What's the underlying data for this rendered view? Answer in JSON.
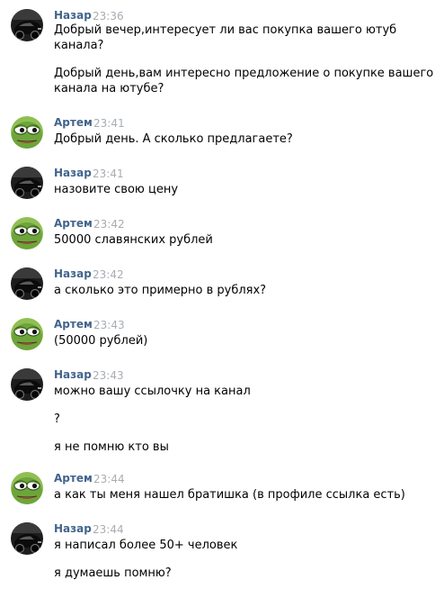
{
  "messages": [
    {
      "author": "Назар",
      "time": "23:36",
      "avatar": "black-car-avatar",
      "lines": [
        "Добрый вечер,интересует ли вас покупка вашего ютуб",
        "канала?",
        "Добрый день,вам интересно предложение о покупке вашего",
        "канала на ютубе?"
      ]
    },
    {
      "author": "Артем",
      "time": "23:41",
      "avatar": "pepe-frog-avatar",
      "lines": [
        "Добрый день. А сколько предлагаете?"
      ]
    },
    {
      "author": "Назар",
      "time": "23:41",
      "avatar": "black-car-avatar",
      "lines": [
        "назовите свою цену"
      ]
    },
    {
      "author": "Артем",
      "time": "23:42",
      "avatar": "pepe-frog-avatar",
      "lines": [
        "50000 славянских рублей"
      ]
    },
    {
      "author": "Назар",
      "time": "23:42",
      "avatar": "black-car-avatar",
      "lines": [
        "а сколько это примерно в рублях?"
      ]
    },
    {
      "author": "Артем",
      "time": "23:43",
      "avatar": "pepe-frog-avatar",
      "lines": [
        "(50000 рублей)"
      ]
    },
    {
      "author": "Назар",
      "time": "23:43",
      "avatar": "black-car-avatar",
      "lines": [
        "можно вашу ссылочку на канал",
        "?",
        "я не помню кто вы"
      ]
    },
    {
      "author": "Артем",
      "time": "23:44",
      "avatar": "pepe-frog-avatar",
      "lines": [
        "а как ты меня нашел братишка (в профиле ссылка есть)"
      ]
    },
    {
      "author": "Назар",
      "time": "23:44",
      "avatar": "black-car-avatar",
      "lines": [
        "я написал более 50+ человек",
        "я думаешь помню?"
      ]
    }
  ],
  "colors": {
    "author_name": "#42648b",
    "timestamp": "#a8adb3",
    "message_text": "#000000",
    "background": "#ffffff"
  }
}
